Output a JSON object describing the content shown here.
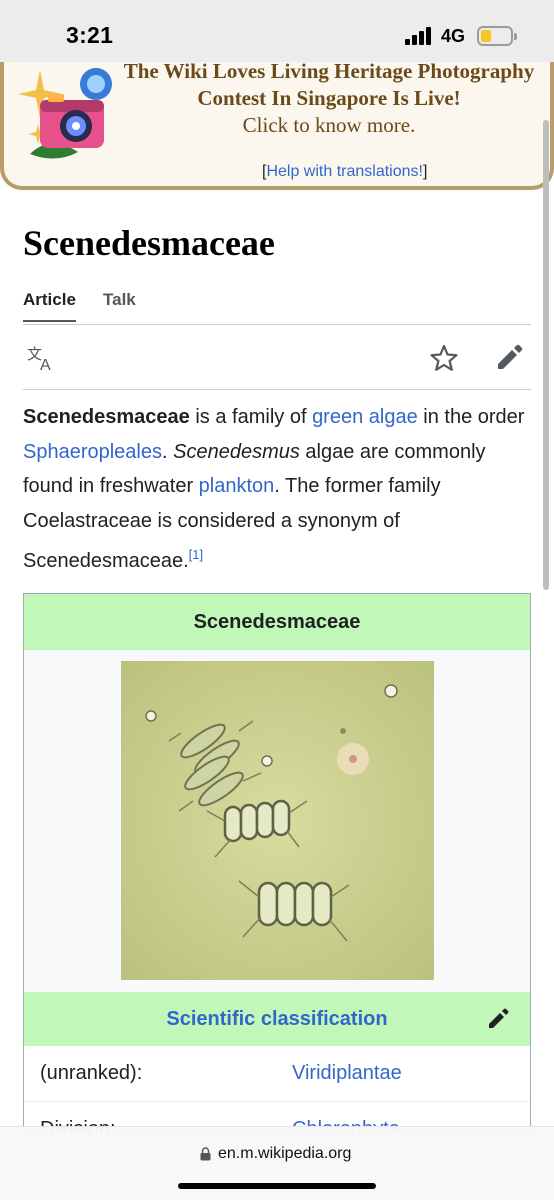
{
  "status_bar": {
    "time": "3:21",
    "network": "4G"
  },
  "banner": {
    "title": "The Wiki Loves Living Heritage Photography Contest In Singapore Is Live!",
    "cta": "Click to know more.",
    "help_open": "[",
    "help_link": "Help with translations!",
    "help_close": "]"
  },
  "page": {
    "title": "Scenedesmaceae",
    "tabs": {
      "article": "Article",
      "talk": "Talk"
    }
  },
  "toolbar": {
    "icons": [
      "translate-icon",
      "star-icon",
      "edit-pencil-icon"
    ]
  },
  "lead": {
    "b1": "Scenedesmaceae",
    "t1": " is a family of ",
    "l1": "green algae",
    "t2": " in the order ",
    "l2": "Sphaeropleales",
    "t3": ". ",
    "i1": "Scenedesmus",
    "t4": " algae are commonly found in freshwater ",
    "l3": "plankton",
    "t5": ". The former family Coelastraceae is considered a synonym of Scenedesmaceae.",
    "ref": "[1]"
  },
  "infobox": {
    "title": "Scenedesmaceae",
    "classification_label": "Scientific classification",
    "rows": [
      {
        "rank": "(unranked):",
        "value": "Viridiplantae"
      },
      {
        "rank": "Division:",
        "value": "Chlorophyta"
      }
    ]
  },
  "url_bar": {
    "url": "en.m.wikipedia.org"
  },
  "colors": {
    "link": "#3366cc",
    "infobox_header": "#c1f8b9",
    "banner_border": "#b79d6a"
  }
}
